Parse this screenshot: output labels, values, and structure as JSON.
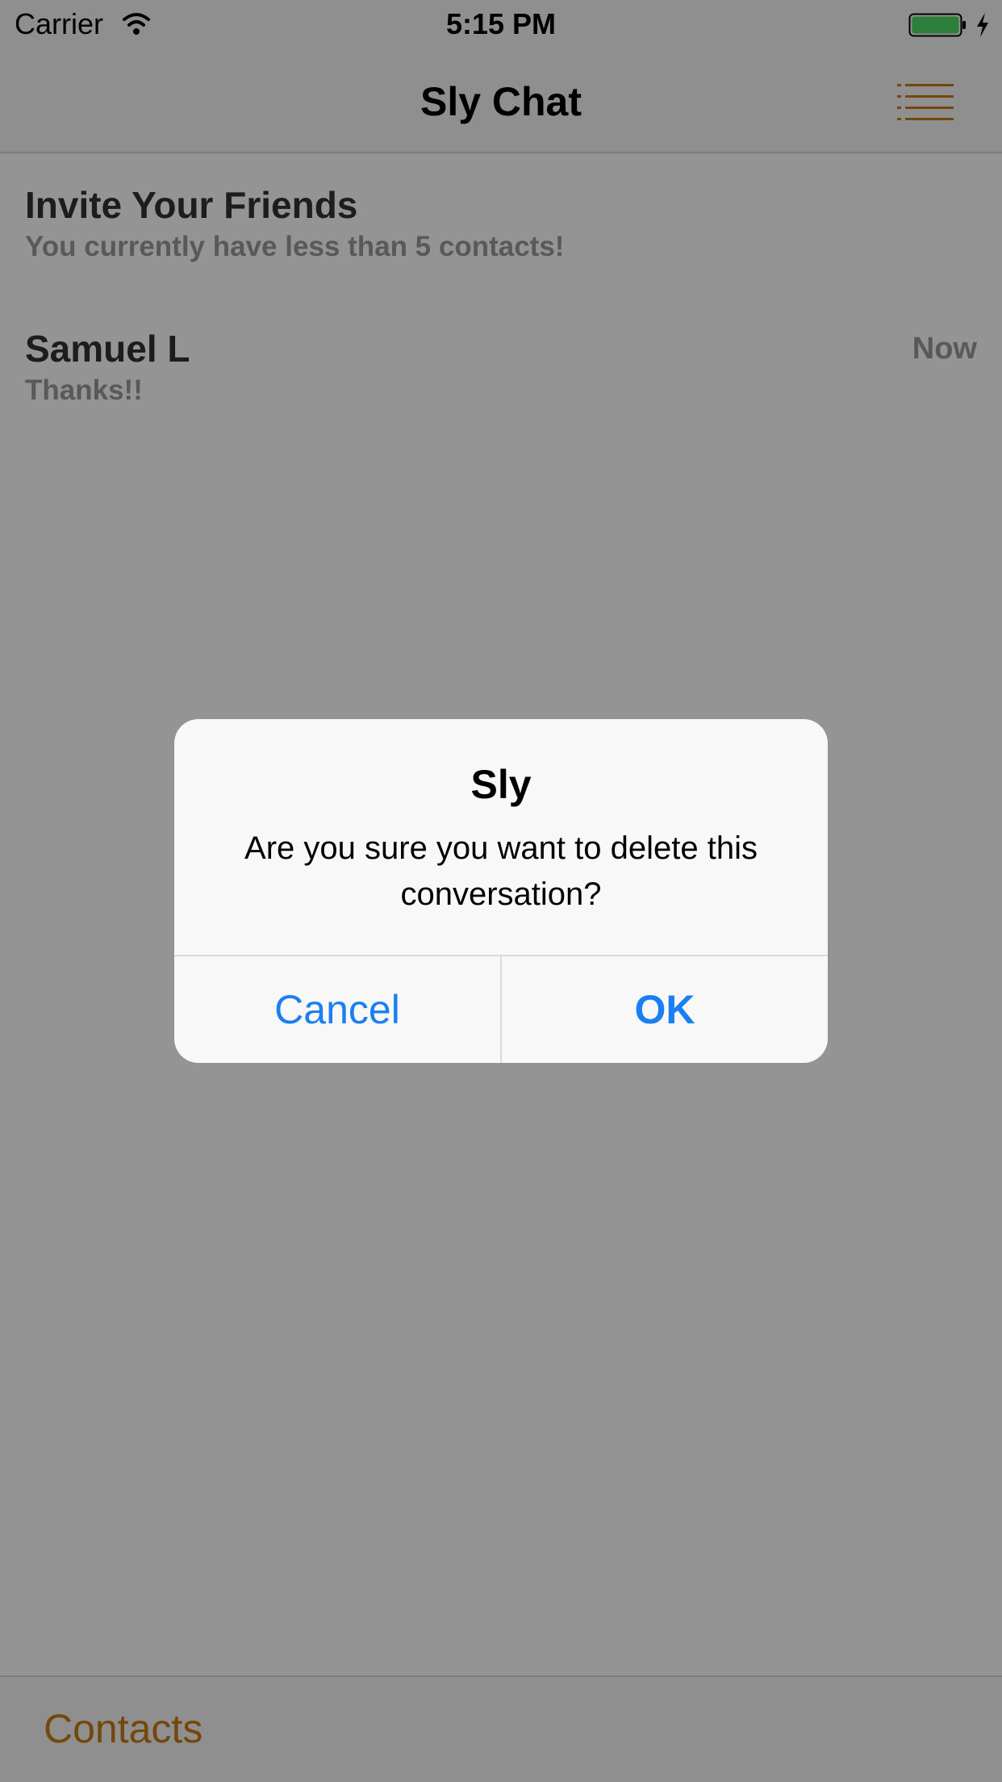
{
  "status_bar": {
    "carrier": "Carrier",
    "time": "5:15 PM",
    "wifi_icon": "wifi-icon",
    "battery_icon": "battery-charging-icon",
    "battery_color": "#4cd964"
  },
  "nav_bar": {
    "title": "Sly Chat",
    "menu_icon": "list-menu-icon",
    "accent_color": "#c87a12"
  },
  "conversations": [
    {
      "title": "Invite Your Friends",
      "subtitle": "You currently have less than 5 contacts!",
      "time": ""
    },
    {
      "title": "Samuel L",
      "subtitle": "Thanks!!",
      "time": "Now"
    }
  ],
  "tab_bar": {
    "contacts_label": "Contacts"
  },
  "alert": {
    "title": "Sly",
    "message": "Are you sure you want to delete this conversation?",
    "cancel_label": "Cancel",
    "ok_label": "OK",
    "button_color": "#1a7ff2"
  }
}
